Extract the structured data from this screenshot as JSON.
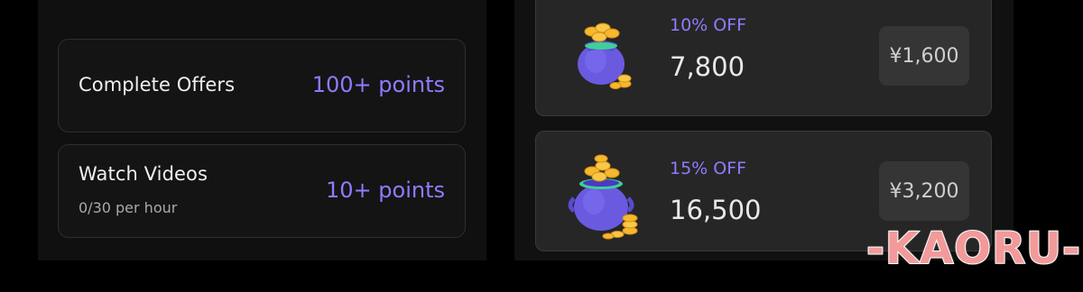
{
  "earn_offers": [
    {
      "title": "Complete Offers",
      "subtitle": "",
      "points": "100+ points"
    },
    {
      "title": "Watch Videos",
      "subtitle": "0/30 per hour",
      "points": "10+ points"
    }
  ],
  "packs": [
    {
      "discount": "10% OFF",
      "amount": "7,800",
      "price": "¥1,600",
      "icon": "coin-bag-icon"
    },
    {
      "discount": "15% OFF",
      "amount": "16,500",
      "price": "¥3,200",
      "icon": "coin-pot-icon"
    }
  ],
  "watermark": "-KAORU-",
  "colors": {
    "accent": "#8d7cff",
    "background": "#000000",
    "card_dark": "#141414",
    "card_gray": "#262626",
    "coin_gold": "#f5b82e",
    "bag_purple": "#6a5ae0"
  }
}
